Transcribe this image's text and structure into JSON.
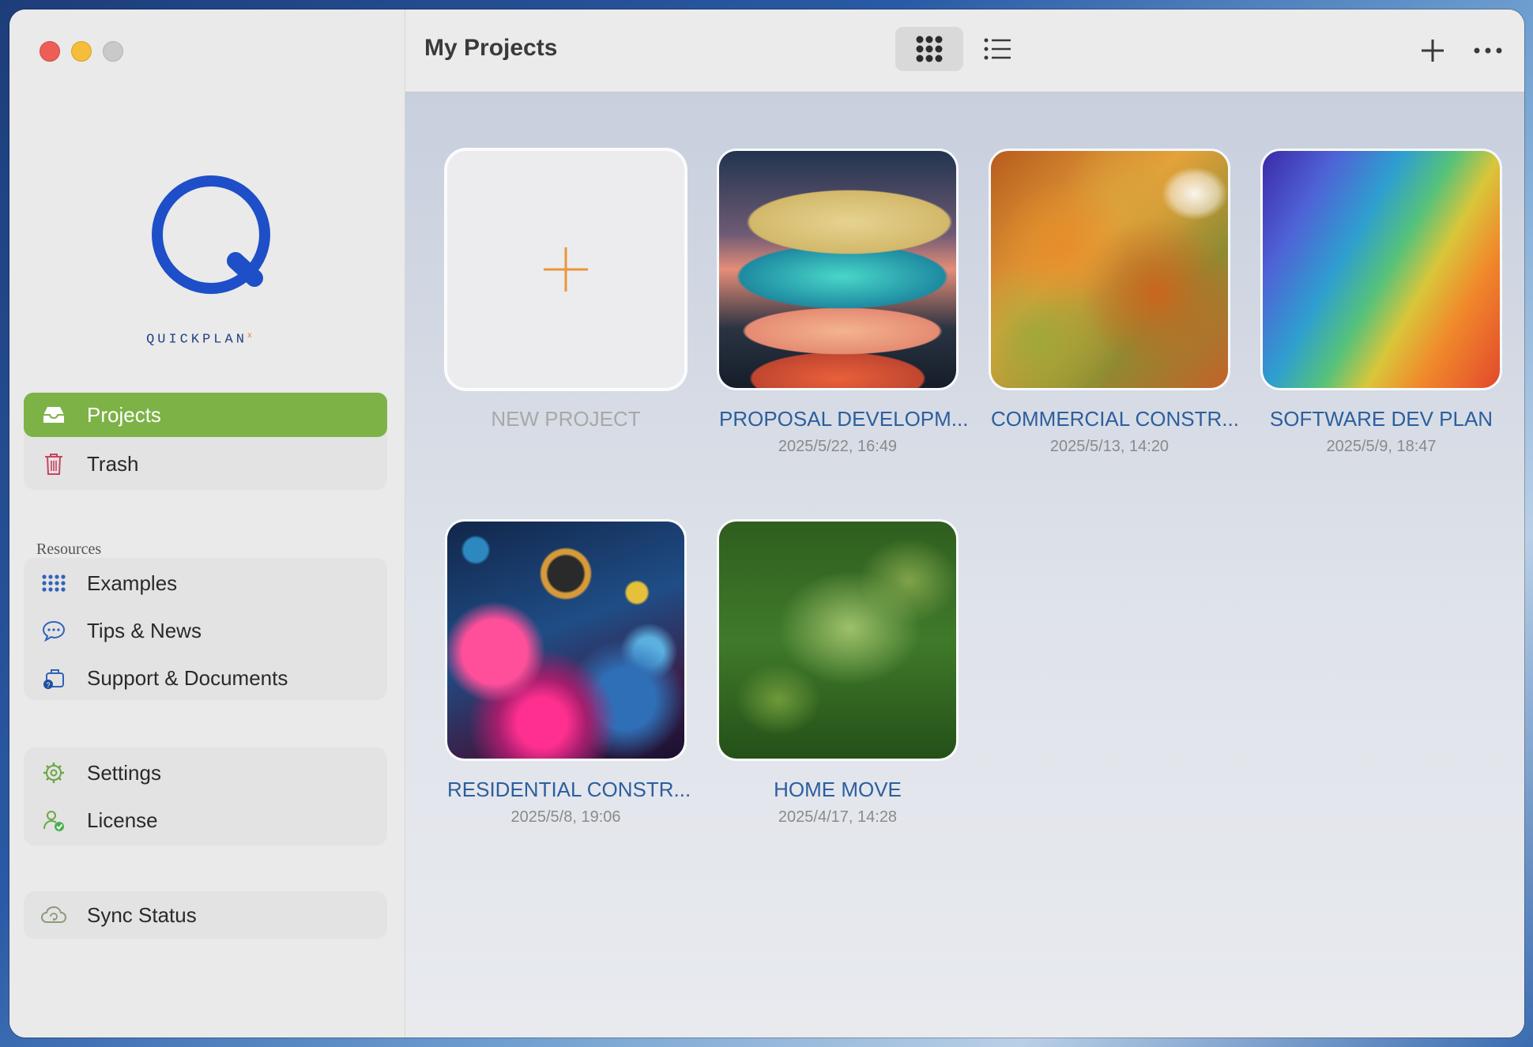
{
  "window": {
    "title": "My Projects",
    "view_modes": [
      "grid-icon",
      "list-icon"
    ],
    "selected_view": "grid"
  },
  "brand": {
    "name": "QUICKPLAN",
    "mark": "x",
    "logo_color": "#1e4fc8",
    "accent": "#7db246"
  },
  "sidebar": {
    "primary": [
      {
        "label": "Projects",
        "icon": "tray-icon",
        "active": true
      },
      {
        "label": "Trash",
        "icon": "trash-icon",
        "active": false
      }
    ],
    "resources_heading": "Resources",
    "resources": [
      {
        "label": "Examples",
        "icon": "grid-dots-icon"
      },
      {
        "label": "Tips & News",
        "icon": "chat-bubble-icon"
      },
      {
        "label": "Support & Documents",
        "icon": "briefcase-question-icon"
      }
    ],
    "account": [
      {
        "label": "Settings",
        "icon": "gear-icon"
      },
      {
        "label": "License",
        "icon": "person-check-icon"
      }
    ],
    "sync": {
      "label": "Sync Status",
      "icon": "cloud-sync-icon"
    }
  },
  "toolbar": {
    "add_icon": "plus-icon",
    "more_icon": "ellipsis-icon"
  },
  "new_project": {
    "label": "NEW PROJECT"
  },
  "projects": [
    {
      "name": "PROPOSAL DEVELOPM...",
      "date": "2025/5/22, 16:49",
      "thumb": "stacked-stones"
    },
    {
      "name": "COMMERCIAL CONSTR...",
      "date": "2025/5/13, 14:20",
      "thumb": "autumn-forest-river"
    },
    {
      "name": "SOFTWARE DEV PLAN",
      "date": "2025/5/9, 18:47",
      "thumb": "rainbow-terrain"
    },
    {
      "name": "RESIDENTIAL CONSTR...",
      "date": "2025/5/8, 19:06",
      "thumb": "colorful-orbs"
    },
    {
      "name": "HOME MOVE",
      "date": "2025/4/17, 14:28",
      "thumb": "green-pond-fish"
    }
  ]
}
